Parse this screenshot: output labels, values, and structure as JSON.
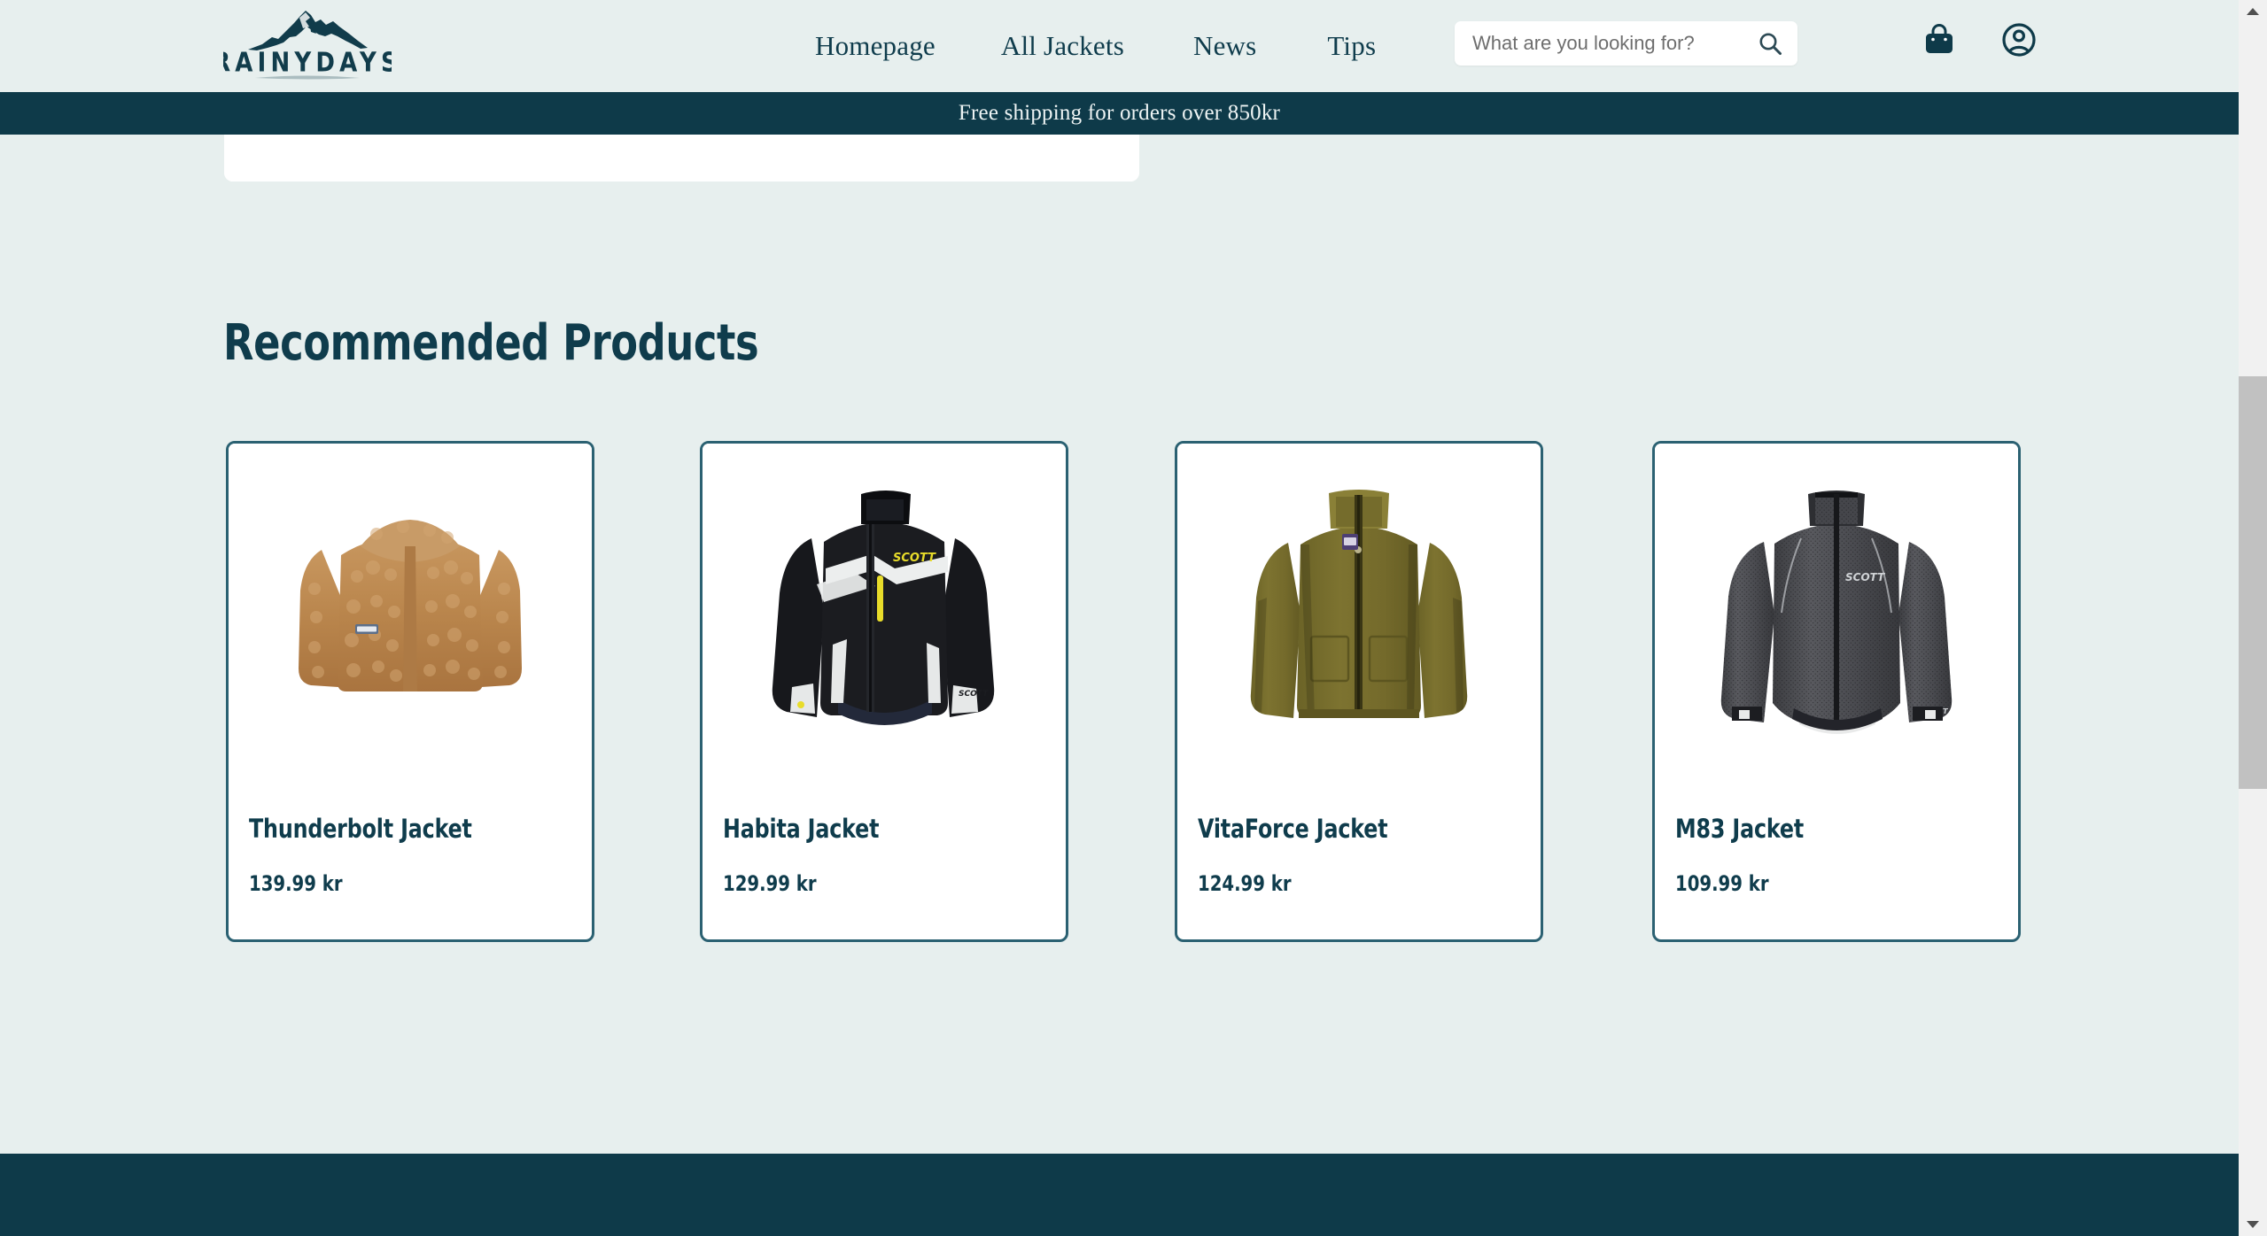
{
  "brand": {
    "name": "RAINYDAYS",
    "logo_icon": "mountain-logo-icon"
  },
  "colors": {
    "page_background": "#e7efee",
    "brand_dark": "#0e3a49",
    "text_dark": "#0f3c4c",
    "card_border": "#2b6172",
    "card_background": "#ffffff",
    "scrollbar_thumb": "#c1c1c1"
  },
  "header": {
    "nav": [
      {
        "label": "Homepage"
      },
      {
        "label": "All Jackets"
      },
      {
        "label": "News"
      },
      {
        "label": "Tips"
      }
    ],
    "search": {
      "placeholder": "What are you looking for?",
      "value": "",
      "icon": "search-icon"
    },
    "icons": [
      {
        "name": "shopping-bag-icon",
        "label": "Cart"
      },
      {
        "name": "account-circle-icon",
        "label": "Account"
      }
    ]
  },
  "banner": {
    "text": "Free shipping for orders over 850kr"
  },
  "main": {
    "section_title": "Recommended Products",
    "products": [
      {
        "title": "Thunderbolt Jacket",
        "price": "139.99 kr",
        "image": "brown-sherpa-fleece-jacket"
      },
      {
        "title": "Habita Jacket",
        "price": "129.99 kr",
        "image": "black-white-scott-ski-jacket"
      },
      {
        "title": "VitaForce Jacket",
        "price": "124.99 kr",
        "image": "olive-green-fleece-jacket"
      },
      {
        "title": "M83 Jacket",
        "price": "109.99 kr",
        "image": "grey-lightweight-cycling-jacket"
      }
    ]
  },
  "scrollbar": {
    "up_arrow": "chevron-up-icon",
    "down_arrow": "chevron-down-icon"
  }
}
